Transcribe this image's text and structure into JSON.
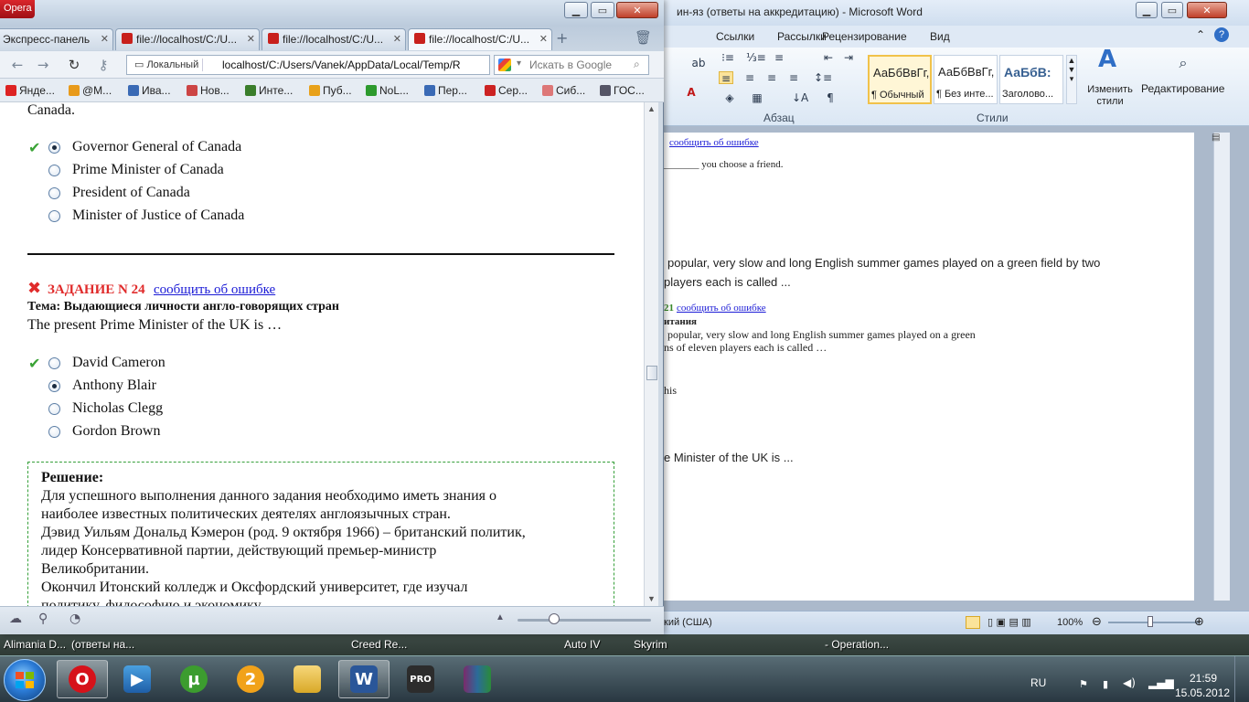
{
  "opera": {
    "title": "Opera",
    "tabs": [
      {
        "label": "Экспресс-панель"
      },
      {
        "label": "file://localhost/C:/U..."
      },
      {
        "label": "file://localhost/C:/U..."
      },
      {
        "label": "file://localhost/C:/U..."
      }
    ],
    "address_prefix": "Локальный",
    "address": "localhost/C:/Users/Vanek/AppData/Local/Temp/R",
    "search_placeholder": "Искать в Google",
    "bookmarks": [
      {
        "label": "Янде...",
        "color": "#d22"
      },
      {
        "label": "@M...",
        "color": "#e89a1a"
      },
      {
        "label": "Ива...",
        "color": "#3a6ab5"
      },
      {
        "label": "Нов...",
        "color": "#c44"
      },
      {
        "label": "Инте...",
        "color": "#3a7d2a"
      },
      {
        "label": "Пуб...",
        "color": "#e8a11a"
      },
      {
        "label": "NoL...",
        "color": "#2d9a2d"
      },
      {
        "label": "Пер...",
        "color": "#3a6ab5"
      },
      {
        "label": "Сер...",
        "color": "#c22"
      },
      {
        "label": "Сиб...",
        "color": "#d77"
      },
      {
        "label": "ГОС...",
        "color": "#556"
      }
    ],
    "content": {
      "prev_tail": "Canada.",
      "prev_options": [
        "Governor General of Canada",
        "Prime Minister of Canada",
        "President of Canada",
        "Minister of Justice of Canada"
      ],
      "task_label": "ЗАДАНИЕ N 24",
      "report_link": "сообщить об ошибке",
      "topic": "Тема: Выдающиеся личности англо-говорящих стран",
      "question": "The present Prime Minister of the UK is …",
      "options": [
        "David Cameron",
        "Anthony Blair",
        "Nicholas Clegg",
        "Gordon Brown"
      ],
      "solution_title": "Решение:",
      "solution_lines": [
        "Для успешного выполнения данного задания необходимо иметь знания о",
        "наиболее известных политических деятелях англоязычных стран.",
        "Дэвид Уильям Дональд Кэмерон (род. 9 октября 1966) – британский политик,",
        "лидер Консервативной партии, действующий премьер-министр",
        "Великобритании.",
        "Окончил Итонский колледж и Оксфордский университет, где изучал",
        "политику, философию и экономику."
      ]
    }
  },
  "word": {
    "title": "ин-яз (ответы на аккредитацию)  -  Microsoft Word",
    "tabs": [
      "Ссылки",
      "Рассылки",
      "Рецензирование",
      "Вид"
    ],
    "groups": {
      "paragraph": "Абзац",
      "styles": "Стили"
    },
    "styles": [
      {
        "sample": "АаБбВвГг,",
        "name": "¶ Обычный"
      },
      {
        "sample": "АаБбВвГг,",
        "name": "¶ Без инте..."
      },
      {
        "sample": "АаБбВ:",
        "name": "Заголово..."
      }
    ],
    "change_styles": "Изменить стили",
    "editing": "Редактирование",
    "doc_lines": {
      "l1_link": "сообщить об ошибке",
      "l2": "_______ you choose a friend.",
      "l3": "popular, very slow and long English summer games played on a green field by two",
      "l4": "players each is called ...",
      "l5_num": "21",
      "l5_link": "сообщить об ошибке",
      "l6": "итания",
      "l7": "popular, very slow and long English summer games played on a green",
      "l8": "ns of eleven players each is called …",
      "l9": "his",
      "l10": "e Minister of the UK is ..."
    },
    "status_lang": "кий (США)",
    "zoom": "100%"
  },
  "desktop": {
    "labels": [
      "Alimania D...",
      "(ответы на...",
      "Creed Re...",
      "Auto IV",
      "Skyrim",
      "- Operation..."
    ]
  },
  "taskbar": {
    "lang": "RU",
    "time": "21:59",
    "date": "15.05.2012"
  }
}
